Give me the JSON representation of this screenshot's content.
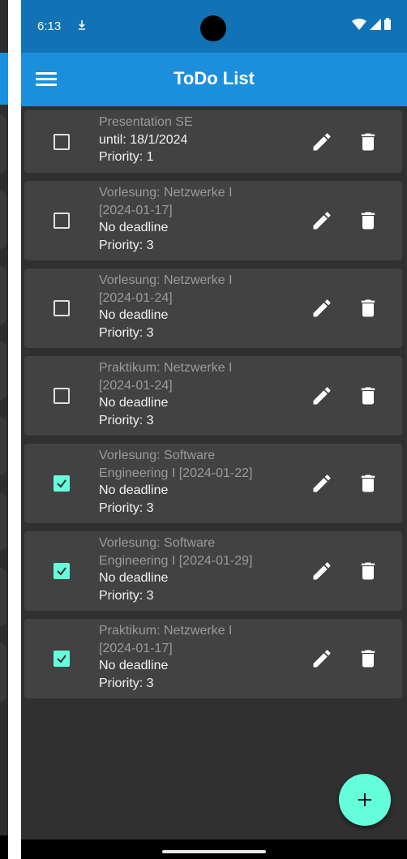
{
  "status_bar": {
    "time": "6:13"
  },
  "app_bar": {
    "title": "ToDo List"
  },
  "icons": {
    "menu": "menu-icon",
    "edit": "pencil-icon",
    "delete": "trash-icon",
    "add": "plus-icon",
    "checkbox": "checkbox-icon"
  },
  "colors": {
    "status_bar": "#1173b5",
    "app_bar": "#1c8fdc",
    "background": "#303030",
    "card": "#424242",
    "accent": "#64ffda",
    "title_text": "#9a9a9a",
    "meta_text": "#f2f2f2"
  },
  "tasks": [
    {
      "title_lines": [
        "Presentation SE"
      ],
      "deadline": "until: 18/1/2024",
      "priority": "Priority: 1",
      "checked": false
    },
    {
      "title_lines": [
        "Vorlesung: Netzwerke I",
        "[2024-01-17]"
      ],
      "deadline": "No deadline",
      "priority": "Priority: 3",
      "checked": false
    },
    {
      "title_lines": [
        "Vorlesung: Netzwerke I",
        "[2024-01-24]"
      ],
      "deadline": "No deadline",
      "priority": "Priority: 3",
      "checked": false
    },
    {
      "title_lines": [
        "Praktikum: Netzwerke I",
        "[2024-01-24]"
      ],
      "deadline": "No deadline",
      "priority": "Priority: 3",
      "checked": false
    },
    {
      "title_lines": [
        "Vorlesung: Software",
        "Engineering I [2024-01-22]"
      ],
      "deadline": "No deadline",
      "priority": "Priority: 3",
      "checked": true
    },
    {
      "title_lines": [
        "Vorlesung: Software",
        "Engineering I [2024-01-29]"
      ],
      "deadline": "No deadline",
      "priority": "Priority: 3",
      "checked": true
    },
    {
      "title_lines": [
        "Praktikum: Netzwerke I",
        "[2024-01-17]"
      ],
      "deadline": "No deadline",
      "priority": "Priority: 3",
      "checked": true
    }
  ]
}
